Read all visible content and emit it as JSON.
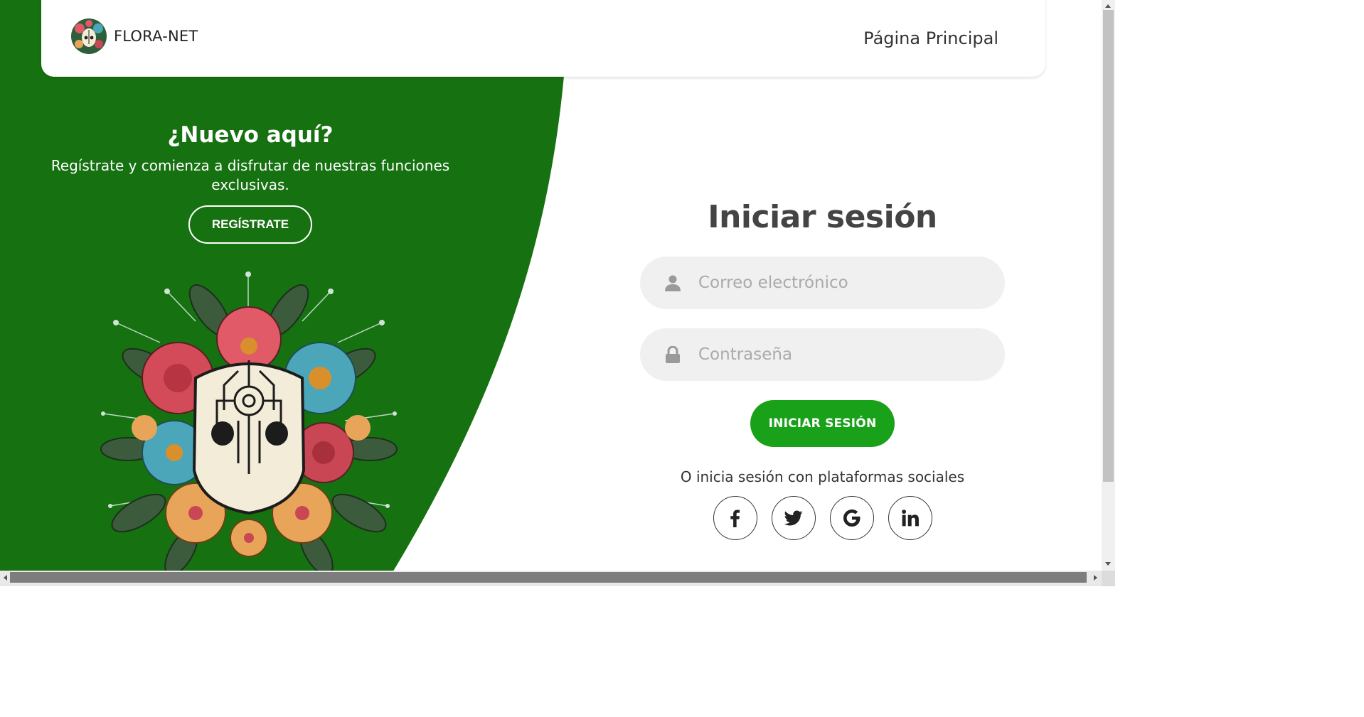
{
  "navbar": {
    "brand": "FLORA-NET",
    "link": "Página Principal"
  },
  "signup_panel": {
    "title": "¿Nuevo aquí?",
    "subtitle": "Regístrate y comienza a disfrutar de nuestras funciones exclusivas.",
    "button": "REGÍSTRATE",
    "background_color": "#167111"
  },
  "login_form": {
    "title": "Iniciar sesión",
    "email": {
      "placeholder": "Correo electrónico",
      "value": "",
      "icon": "user-icon"
    },
    "password": {
      "placeholder": "Contraseña",
      "value": "",
      "icon": "lock-icon"
    },
    "submit": "INICIAR SESIÓN",
    "submit_color": "#1aa11a",
    "social_text": "O inicia sesión con plataformas sociales",
    "social": [
      {
        "name": "facebook",
        "icon": "facebook-icon"
      },
      {
        "name": "twitter",
        "icon": "twitter-icon"
      },
      {
        "name": "google",
        "icon": "google-icon"
      },
      {
        "name": "linkedin",
        "icon": "linkedin-icon"
      }
    ]
  }
}
